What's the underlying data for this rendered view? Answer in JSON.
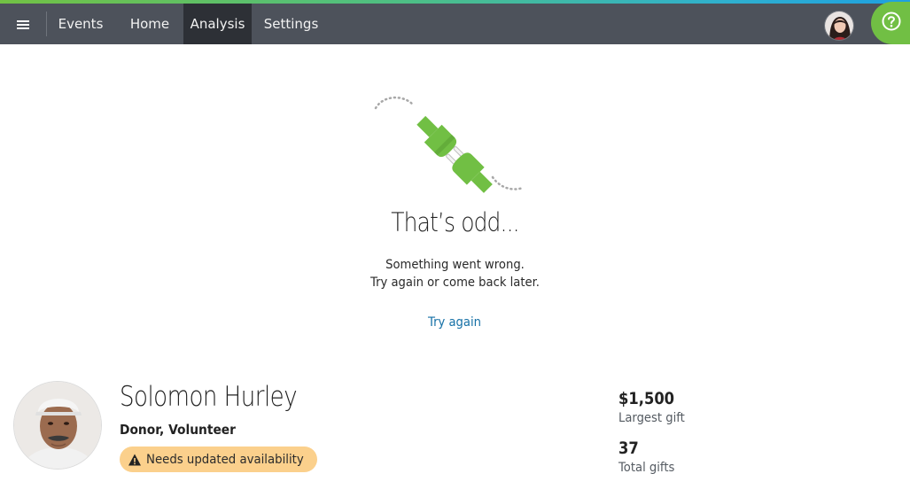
{
  "nav": {
    "menu_icon": "hamburger-icon",
    "items": [
      {
        "label": "Events",
        "active": false
      },
      {
        "label": "Home",
        "active": false
      },
      {
        "label": "Analysis",
        "active": true
      },
      {
        "label": "Settings",
        "active": false
      }
    ],
    "help_icon": "question-circle-icon",
    "accent_color": "#71bf44",
    "bar_color": "#4d525b"
  },
  "error": {
    "illustration": "unplugged-plug-icon",
    "title": "That’s odd...",
    "message_line1": "Something went wrong.",
    "message_line2": "Try again or come back later.",
    "retry_link": "Try again"
  },
  "profile": {
    "name": "Solomon Hurley",
    "roles": "Donor, Volunteer",
    "badge": {
      "icon": "warning-triangle-icon",
      "text": "Needs updated availability",
      "color": "#fbd08c"
    },
    "stats": [
      {
        "value": "$1,500",
        "label": "Largest gift"
      },
      {
        "value": "37",
        "label": "Total gifts"
      }
    ]
  }
}
